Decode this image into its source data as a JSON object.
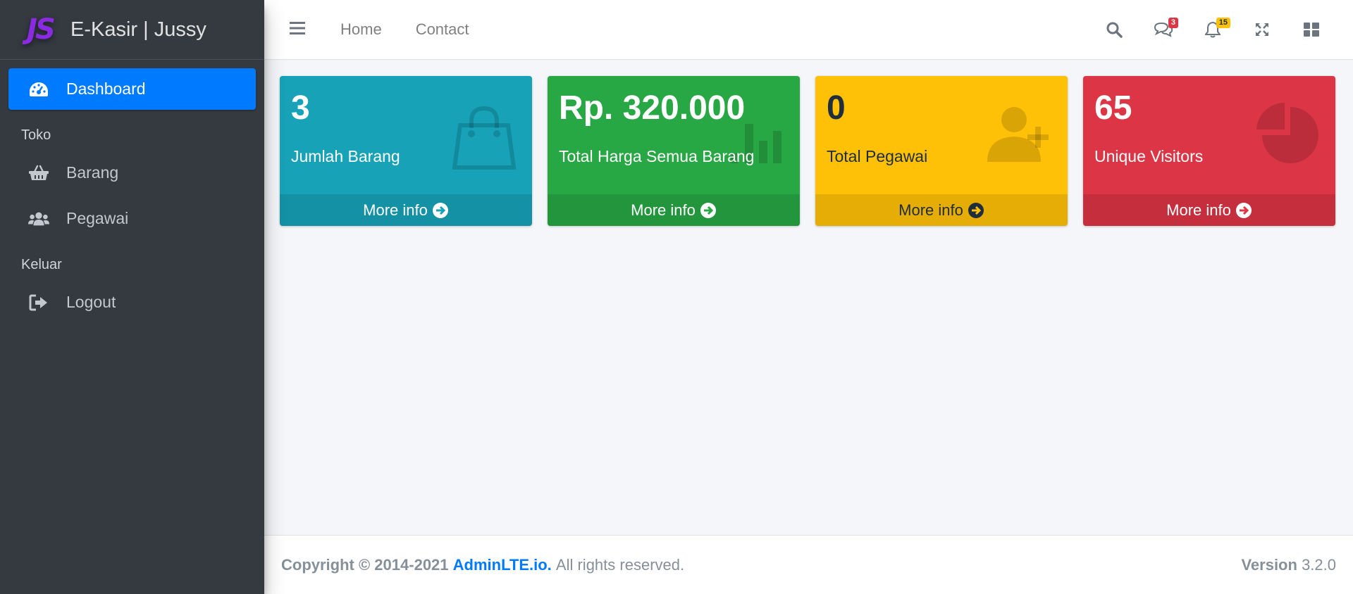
{
  "brand": {
    "logo_text": "JS",
    "name": "E-Kasir | Jussy"
  },
  "sidebar": {
    "items": [
      {
        "label": "Dashboard",
        "icon": "tachometer-icon",
        "active": true
      },
      {
        "header": "Toko"
      },
      {
        "label": "Barang",
        "icon": "basket-icon"
      },
      {
        "label": "Pegawai",
        "icon": "users-icon"
      },
      {
        "header": "Keluar"
      },
      {
        "label": "Logout",
        "icon": "sign-out-icon"
      }
    ],
    "dashboard": "Dashboard",
    "toko_header": "Toko",
    "barang": "Barang",
    "pegawai": "Pegawai",
    "keluar_header": "Keluar",
    "logout": "Logout"
  },
  "topbar": {
    "links": [
      "Home",
      "Contact"
    ],
    "home": "Home",
    "contact": "Contact",
    "messages_badge": "3",
    "notifications_badge": "15"
  },
  "cards": {
    "c1": {
      "value": "3",
      "label": "Jumlah Barang",
      "more": "More info",
      "color": "#17a2b8",
      "icon": "shopping-bag-icon"
    },
    "c2": {
      "value": "Rp. 320.000",
      "label": "Total Harga Semua Barang",
      "more": "More info",
      "color": "#28a745",
      "icon": "stats-bars-icon"
    },
    "c3": {
      "value": "0",
      "label": "Total Pegawai",
      "more": "More info",
      "color": "#ffc107",
      "icon": "person-add-icon"
    },
    "c4": {
      "value": "65",
      "label": "Unique Visitors",
      "more": "More info",
      "color": "#dc3545",
      "icon": "pie-graph-icon"
    }
  },
  "footer": {
    "copyright": "Copyright © 2014-2021",
    "brand_link": "AdminLTE.io.",
    "rights": "All rights reserved.",
    "version_label": "Version",
    "version": "3.2.0"
  },
  "colors": {
    "sidebar_bg": "#343a40",
    "primary": "#007bff",
    "background": "#f4f6f9"
  }
}
